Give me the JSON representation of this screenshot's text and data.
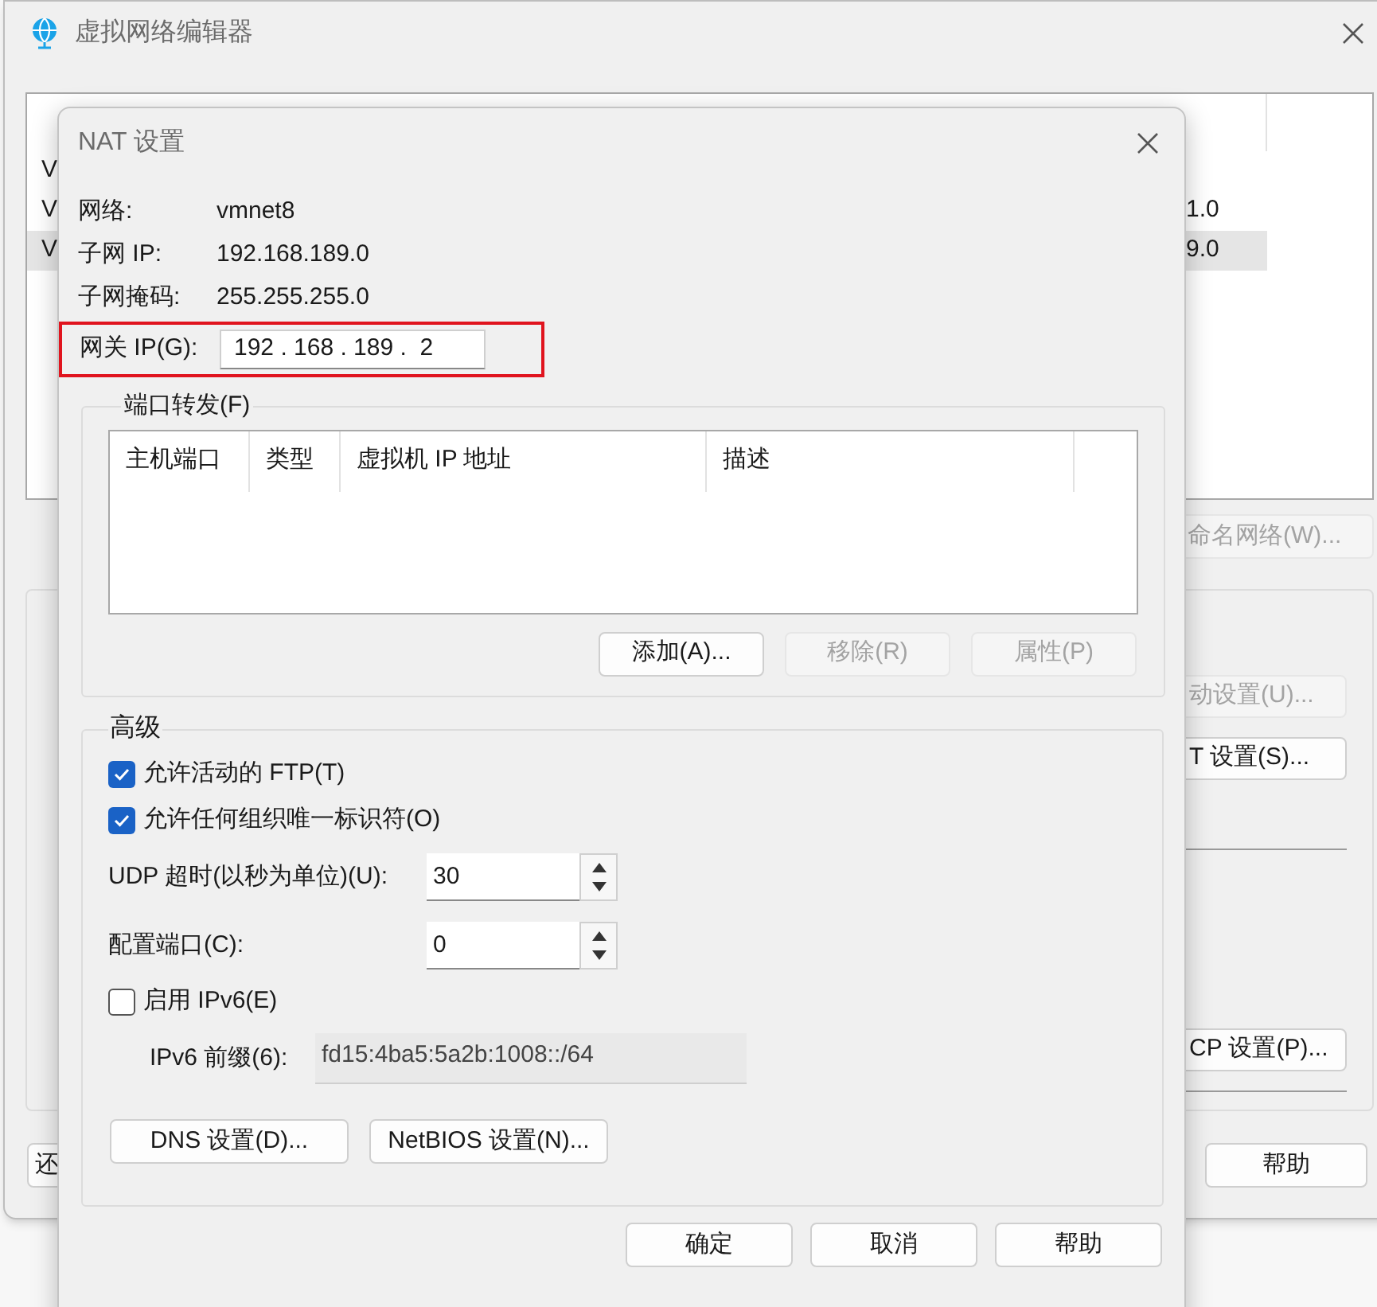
{
  "main_window": {
    "title": "虚拟网络编辑器",
    "network_list": {
      "rows": [
        {
          "column_1": "V",
          "selected": false
        },
        {
          "column_1": "V",
          "column_6": "1.0",
          "selected": false
        },
        {
          "column_1": "V",
          "column_6": "9.0",
          "selected": true
        }
      ]
    },
    "rename_button": {
      "label": "命名网络(W)...",
      "disabled": true
    },
    "settings_buttons": [
      {
        "label": "动设置(U)...",
        "disabled": true
      },
      {
        "label": "T 设置(S)...",
        "disabled": false
      },
      {
        "label": "CP 设置(P)...",
        "disabled": false
      }
    ],
    "bottom_left_button": "还",
    "help_button": "帮助"
  },
  "nat_dialog": {
    "title": "NAT 设置",
    "info": [
      {
        "label": "网络:",
        "value": "vmnet8"
      },
      {
        "label": "子网 IP:",
        "value": "192.168.189.0"
      },
      {
        "label": "子网掩码:",
        "value": "255.255.255.0"
      }
    ],
    "gateway": {
      "label": "网关 IP(G):",
      "value": "192 . 168 . 189 .  2",
      "highlighted": true
    },
    "port_forwarding": {
      "title": "端口转发(F)",
      "columns": [
        "主机端口",
        "类型",
        "虚拟机 IP 地址",
        "描述"
      ],
      "buttons": [
        {
          "label": "添加(A)...",
          "disabled": false
        },
        {
          "label": "移除(R)",
          "disabled": true
        },
        {
          "label": "属性(P)",
          "disabled": true
        }
      ]
    },
    "advanced": {
      "title": "高级",
      "options": [
        {
          "label": "允许活动的 FTP(T)",
          "checked": true
        },
        {
          "label": "允许任何组织唯一标识符(O)",
          "checked": true
        }
      ],
      "udp_timeout": {
        "label": "UDP 超时(以秒为单位)(U):",
        "value": "30"
      },
      "config_port": {
        "label": "配置端口(C):",
        "value": "0"
      },
      "ipv6": {
        "label": "启用 IPv6(E)",
        "checked": false
      },
      "ipv6_prefix": {
        "label": "IPv6 前缀(6):",
        "value": "fd15:4ba5:5a2b:1008::/64",
        "disabled": true
      },
      "buttons": [
        "DNS 设置(D)...",
        "NetBIOS 设置(N)..."
      ]
    },
    "buttons": [
      "确定",
      "取消",
      "帮助"
    ]
  }
}
